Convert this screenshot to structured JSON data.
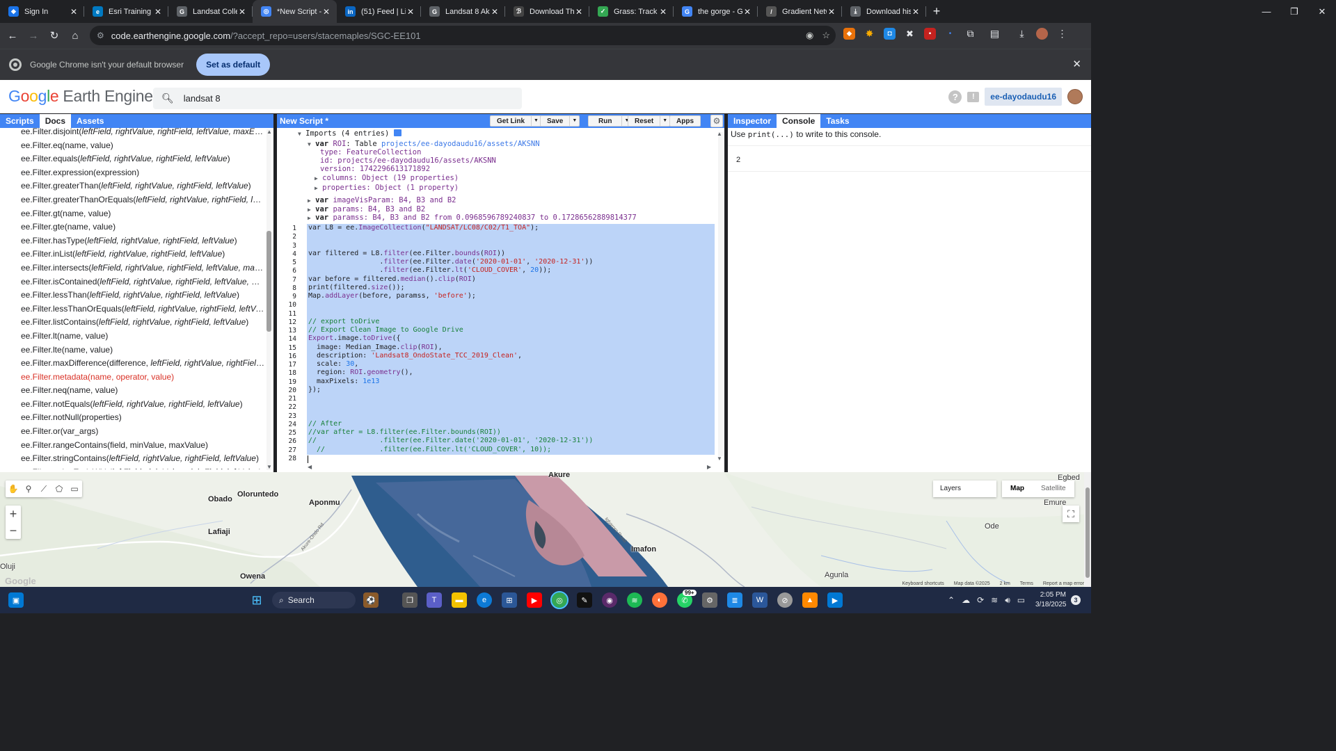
{
  "browser": {
    "tabs": [
      {
        "title": "Sign In",
        "color": "#1a73e8",
        "glyph": "◆"
      },
      {
        "title": "Esri Training |",
        "color": "#0079c1",
        "glyph": "e"
      },
      {
        "title": "Landsat Collec",
        "color": "#5f6368",
        "glyph": "G"
      },
      {
        "title": "*New Script -",
        "color": "#4285f4",
        "glyph": "◎",
        "active": true
      },
      {
        "title": "(51) Feed | Lin",
        "color": "#0a66c2",
        "glyph": "in"
      },
      {
        "title": "Landsat 8 Aku",
        "color": "#5f6368",
        "glyph": "G"
      },
      {
        "title": "Download The",
        "color": "#444",
        "glyph": "ℬ"
      },
      {
        "title": "Grass: Track Yo",
        "color": "#34a853",
        "glyph": "✓"
      },
      {
        "title": "the gorge - Go",
        "color": "#4285f4",
        "glyph": "G"
      },
      {
        "title": "Gradient Netw",
        "color": "#555",
        "glyph": "/"
      },
      {
        "title": "Download his",
        "color": "#5f6368",
        "glyph": "⤓"
      }
    ],
    "new_tab": "+",
    "window_controls": {
      "minimize": "—",
      "maximize": "❐",
      "close": "✕"
    },
    "url_host": "code.earthengine.google.com",
    "url_path": "/?accept_repo=users/stacemaples/SGC-EE101",
    "infobar_message": "Google Chrome isn't your default browser",
    "infobar_button": "Set as default"
  },
  "gee": {
    "logo_google": "Google",
    "logo_rest": "Earth Engine",
    "search_value": "landsat 8",
    "username": "ee-dayodaudu16",
    "help_glyph": "?",
    "feedback_glyph": "!"
  },
  "left_tabs": [
    "Scripts",
    "Docs",
    "Assets"
  ],
  "docs": [
    {
      "name": "ee.Filter.disjoint(",
      "args": "leftField, rightValue, rightField, leftValue, maxError",
      "end": ")"
    },
    {
      "name": "ee.Filter.eq(name, value)",
      "args": "",
      "end": ""
    },
    {
      "name": "ee.Filter.equals(",
      "args": "leftField, rightValue, rightField, leftValue",
      "end": ")"
    },
    {
      "name": "ee.Filter.expression(expression)",
      "args": "",
      "end": ""
    },
    {
      "name": "ee.Filter.greaterThan(",
      "args": "leftField, rightValue, rightField, leftValue",
      "end": ")"
    },
    {
      "name": "ee.Filter.greaterThanOrEquals(",
      "args": "leftField, rightValue, rightField, left...",
      "end": ""
    },
    {
      "name": "ee.Filter.gt(name, value)",
      "args": "",
      "end": ""
    },
    {
      "name": "ee.Filter.gte(name, value)",
      "args": "",
      "end": ""
    },
    {
      "name": "ee.Filter.hasType(",
      "args": "leftField, rightValue, rightField, leftValue",
      "end": ")"
    },
    {
      "name": "ee.Filter.inList(",
      "args": "leftField, rightValue, rightField, leftValue",
      "end": ")"
    },
    {
      "name": "ee.Filter.intersects(",
      "args": "leftField, rightValue, rightField, leftValue, maxE...",
      "end": ""
    },
    {
      "name": "ee.Filter.isContained(",
      "args": "leftField, rightValue, rightField, leftValue, ma...",
      "end": ""
    },
    {
      "name": "ee.Filter.lessThan(",
      "args": "leftField, rightValue, rightField, leftValue",
      "end": ")"
    },
    {
      "name": "ee.Filter.lessThanOrEquals(",
      "args": "leftField, rightValue, rightField, leftVal...",
      "end": ""
    },
    {
      "name": "ee.Filter.listContains(",
      "args": "leftField, rightValue, rightField, leftValue",
      "end": ")"
    },
    {
      "name": "ee.Filter.lt(name, value)",
      "args": "",
      "end": ""
    },
    {
      "name": "ee.Filter.lte(name, value)",
      "args": "",
      "end": ""
    },
    {
      "name": "ee.Filter.maxDifference(difference, ",
      "args": "leftField, rightValue, rightField,...",
      "end": ""
    },
    {
      "name": "ee.Filter.metadata(name, operator, value)",
      "args": "",
      "end": "",
      "red": true
    },
    {
      "name": "ee.Filter.neq(name, value)",
      "args": "",
      "end": ""
    },
    {
      "name": "ee.Filter.notEquals(",
      "args": "leftField, rightValue, rightField, leftValue",
      "end": ")"
    },
    {
      "name": "ee.Filter.notNull(properties)",
      "args": "",
      "end": ""
    },
    {
      "name": "ee.Filter.or(var_args)",
      "args": "",
      "end": ""
    },
    {
      "name": "ee.Filter.rangeContains(field, minValue, maxValue)",
      "args": "",
      "end": ""
    },
    {
      "name": "ee.Filter.stringContains(",
      "args": "leftField, rightValue, rightField, leftValue",
      "end": ")"
    },
    {
      "name": "ee.Filter.stringEndsWith(",
      "args": "leftField, rightValue, rightField, leftValue",
      "end": ")"
    }
  ],
  "editor": {
    "title": "New Script *",
    "buttons": {
      "get_link": "Get Link",
      "save": "Save",
      "run": "Run",
      "reset": "Reset",
      "apps": "Apps"
    },
    "imports_header": "Imports (4 entries)",
    "roi_var": "ROI",
    "roi_type_prefix": ": Table ",
    "roi_link": "projects/ee-dayodaudu16/assets/AKSNN",
    "roi_type": "type: FeatureCollection",
    "roi_id": "id: projects/ee-dayodaudu16/assets/AKSNN",
    "roi_version": "version: 1742296613171892",
    "roi_columns": "columns: Object (19 properties)",
    "roi_properties": "properties: Object (1 property)",
    "imp2": "imageVisParam: B4, B3 and B2",
    "imp3": "params: B4, B3 and B2",
    "imp4": "paramss: B4, B3 and B2 from 0.0968596789240837 to 0.17286562889814377",
    "code_lines": [
      "var L8 = ee.ImageCollection(\"LANDSAT/LC08/C02/T1_TOA\");",
      "",
      "",
      "var filtered = L8.filter(ee.Filter.bounds(ROI))",
      "                 .filter(ee.Filter.date('2020-01-01', '2020-12-31'))",
      "                 .filter(ee.Filter.lt('CLOUD_COVER', 20));",
      "var before = filtered.median().clip(ROI)",
      "print(filtered.size());",
      "Map.addLayer(before, paramss, 'before');",
      "",
      "",
      "// export toDrive",
      "// Export Clean Image to Google Drive",
      "Export.image.toDrive({",
      "  image: Median_Image.clip(ROI),",
      "  description: 'Landsat8_OndoState_TCC_2019_Clean',",
      "  scale: 30,",
      "  region: ROI.geometry(),",
      "  maxPixels: 1e13",
      "});",
      "",
      "",
      "",
      "// After",
      "//var after = L8.filter(ee.Filter.bounds(ROI))",
      "//               .filter(ee.Filter.date('2020-01-01', '2020-12-31'))",
      "  //             .filter(ee.Filter.lt('CLOUD_COVER', 10));",
      ""
    ]
  },
  "right_tabs": [
    "Inspector",
    "Console",
    "Tasks"
  ],
  "console": {
    "hint_pre": "Use ",
    "hint_code": "print(...)",
    "hint_post": " to write to this console.",
    "output": "2"
  },
  "map": {
    "places": [
      "Obado",
      "Oloruntedo",
      "Aponmu",
      "Lafiaji",
      "Akure",
      "Imafon",
      "Owena",
      "Agunla",
      "Oluji",
      "Ode",
      "Emure",
      "Egbed"
    ],
    "roads": [
      "Akure-Ondo Rd",
      "Igbaroro Road"
    ],
    "layers_label": "Layers",
    "map_button": "Map",
    "satellite_button": "Satellite",
    "watermark": "Google",
    "attribution": [
      "Keyboard shortcuts",
      "Map data ©2025",
      "2 km",
      "Terms",
      "Report a map error"
    ]
  },
  "taskbar": {
    "search": "Search",
    "whatsapp_badge": "99+",
    "time": "2:05 PM",
    "date": "3/18/2025",
    "notifications": "3"
  }
}
